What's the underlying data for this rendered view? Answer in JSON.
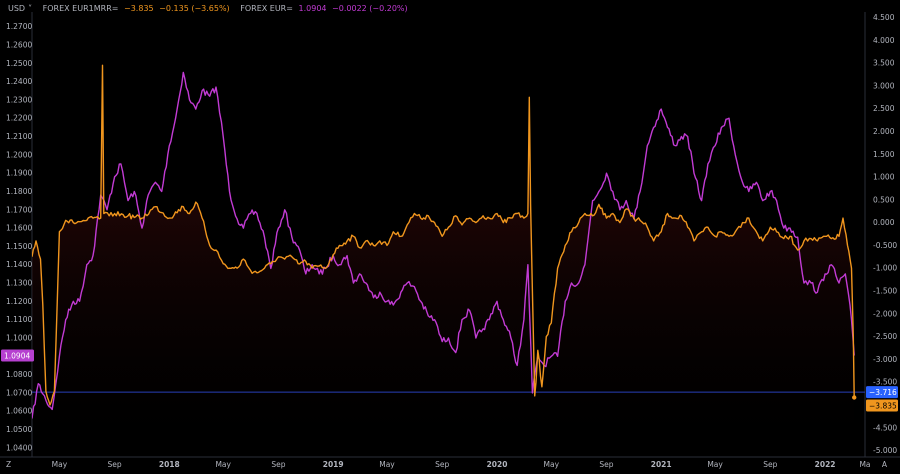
{
  "legend": {
    "currency": "USD",
    "currency_caret": "˅",
    "s1_name": "FOREX EUR1MRR=",
    "s1_value": "−3.835",
    "s1_change": "−0.135 (−3.65%)",
    "s2_name": "FOREX EUR=",
    "s2_value": "1.0904",
    "s2_change": "−0.0022 (−0.20%)"
  },
  "bottom_bar": {
    "left": "Z",
    "right": "A"
  },
  "badges": {
    "left_price": "1.0904",
    "right_a": "−3.716",
    "right_b": "−3.835"
  },
  "colors": {
    "eur_line": "#c23bd4",
    "eur1mrr_line": "#f0961e",
    "fill_top": "#4a0e0e",
    "baseline": "#2a3fb8",
    "badge_blue": "#2962ff",
    "badge_orange": "#f0961e",
    "badge_purple": "#b640d0"
  },
  "chart_data": {
    "type": "line",
    "x_range": [
      "2017-03-01",
      "2022-03-31"
    ],
    "x_tick_labels": [
      "May",
      "Sep",
      "2018",
      "May",
      "Sep",
      "2019",
      "May",
      "Sep",
      "2020",
      "May",
      "Sep",
      "2021",
      "May",
      "Sep",
      "2022",
      "Ma"
    ],
    "left_axis": {
      "ylim": [
        1.035,
        1.278
      ],
      "ticks": [
        "1.2700",
        "1.2600",
        "1.2500",
        "1.2400",
        "1.2300",
        "1.2200",
        "1.2100",
        "1.2000",
        "1.1900",
        "1.1800",
        "1.1700",
        "1.1600",
        "1.1500",
        "1.1400",
        "1.1300",
        "1.1200",
        "1.1100",
        "1.1000",
        "1.0900",
        "1.0800",
        "1.0700",
        "1.0600",
        "1.0500",
        "1.0400"
      ]
    },
    "right_axis": {
      "ylim": [
        -5.14,
        4.62
      ],
      "ticks": [
        "4.500",
        "4.000",
        "3.500",
        "3.000",
        "2.500",
        "2.000",
        "1.500",
        "1.000",
        "0.500",
        "0.000",
        "-0.500",
        "-1.000",
        "-1.500",
        "-2.000",
        "-2.500",
        "-3.000",
        "-3.500",
        "-4.000",
        "-4.500",
        "-5.000"
      ]
    },
    "series": [
      {
        "name": "FOREX EUR=",
        "axis": "left",
        "points": [
          [
            "2017-03-01",
            1.056
          ],
          [
            "2017-03-15",
            1.075
          ],
          [
            "2017-04-01",
            1.066
          ],
          [
            "2017-04-15",
            1.061
          ],
          [
            "2017-05-01",
            1.09
          ],
          [
            "2017-05-15",
            1.11
          ],
          [
            "2017-06-01",
            1.12
          ],
          [
            "2017-06-15",
            1.12
          ],
          [
            "2017-07-01",
            1.14
          ],
          [
            "2017-07-15",
            1.145
          ],
          [
            "2017-08-01",
            1.178
          ],
          [
            "2017-08-15",
            1.17
          ],
          [
            "2017-09-01",
            1.188
          ],
          [
            "2017-09-15",
            1.195
          ],
          [
            "2017-10-01",
            1.175
          ],
          [
            "2017-10-15",
            1.18
          ],
          [
            "2017-11-01",
            1.16
          ],
          [
            "2017-11-15",
            1.178
          ],
          [
            "2017-12-01",
            1.185
          ],
          [
            "2017-12-15",
            1.18
          ],
          [
            "2018-01-01",
            1.205
          ],
          [
            "2018-01-15",
            1.22
          ],
          [
            "2018-02-01",
            1.245
          ],
          [
            "2018-02-15",
            1.23
          ],
          [
            "2018-03-01",
            1.225
          ],
          [
            "2018-03-15",
            1.235
          ],
          [
            "2018-04-01",
            1.232
          ],
          [
            "2018-04-15",
            1.237
          ],
          [
            "2018-05-01",
            1.21
          ],
          [
            "2018-05-15",
            1.18
          ],
          [
            "2018-06-01",
            1.165
          ],
          [
            "2018-06-15",
            1.16
          ],
          [
            "2018-07-01",
            1.168
          ],
          [
            "2018-07-15",
            1.168
          ],
          [
            "2018-08-01",
            1.155
          ],
          [
            "2018-08-15",
            1.138
          ],
          [
            "2018-09-01",
            1.16
          ],
          [
            "2018-09-15",
            1.17
          ],
          [
            "2018-10-01",
            1.155
          ],
          [
            "2018-10-15",
            1.15
          ],
          [
            "2018-11-01",
            1.135
          ],
          [
            "2018-11-15",
            1.14
          ],
          [
            "2018-12-01",
            1.135
          ],
          [
            "2018-12-15",
            1.138
          ],
          [
            "2019-01-01",
            1.145
          ],
          [
            "2019-01-15",
            1.14
          ],
          [
            "2019-02-01",
            1.145
          ],
          [
            "2019-02-15",
            1.13
          ],
          [
            "2019-03-01",
            1.135
          ],
          [
            "2019-03-15",
            1.13
          ],
          [
            "2019-04-01",
            1.122
          ],
          [
            "2019-04-15",
            1.125
          ],
          [
            "2019-05-01",
            1.12
          ],
          [
            "2019-05-15",
            1.118
          ],
          [
            "2019-06-01",
            1.125
          ],
          [
            "2019-06-15",
            1.13
          ],
          [
            "2019-07-01",
            1.128
          ],
          [
            "2019-07-15",
            1.12
          ],
          [
            "2019-08-01",
            1.112
          ],
          [
            "2019-08-15",
            1.11
          ],
          [
            "2019-09-01",
            1.098
          ],
          [
            "2019-09-15",
            1.1
          ],
          [
            "2019-10-01",
            1.092
          ],
          [
            "2019-10-15",
            1.11
          ],
          [
            "2019-11-01",
            1.115
          ],
          [
            "2019-11-15",
            1.1
          ],
          [
            "2019-12-01",
            1.105
          ],
          [
            "2019-12-15",
            1.11
          ],
          [
            "2020-01-01",
            1.12
          ],
          [
            "2020-01-15",
            1.11
          ],
          [
            "2020-02-01",
            1.1
          ],
          [
            "2020-02-15",
            1.085
          ],
          [
            "2020-03-01",
            1.11
          ],
          [
            "2020-03-10",
            1.14
          ],
          [
            "2020-03-20",
            1.07
          ],
          [
            "2020-04-01",
            1.09
          ],
          [
            "2020-04-15",
            1.085
          ],
          [
            "2020-05-01",
            1.09
          ],
          [
            "2020-05-15",
            1.09
          ],
          [
            "2020-06-01",
            1.12
          ],
          [
            "2020-06-15",
            1.13
          ],
          [
            "2020-07-01",
            1.13
          ],
          [
            "2020-07-15",
            1.14
          ],
          [
            "2020-08-01",
            1.175
          ],
          [
            "2020-08-15",
            1.18
          ],
          [
            "2020-09-01",
            1.19
          ],
          [
            "2020-09-15",
            1.18
          ],
          [
            "2020-10-01",
            1.17
          ],
          [
            "2020-10-15",
            1.175
          ],
          [
            "2020-11-01",
            1.165
          ],
          [
            "2020-11-15",
            1.18
          ],
          [
            "2020-12-01",
            1.205
          ],
          [
            "2020-12-15",
            1.215
          ],
          [
            "2021-01-01",
            1.225
          ],
          [
            "2021-01-15",
            1.215
          ],
          [
            "2021-02-01",
            1.205
          ],
          [
            "2021-02-15",
            1.21
          ],
          [
            "2021-03-01",
            1.21
          ],
          [
            "2021-03-15",
            1.19
          ],
          [
            "2021-04-01",
            1.175
          ],
          [
            "2021-04-15",
            1.195
          ],
          [
            "2021-05-01",
            1.205
          ],
          [
            "2021-05-15",
            1.215
          ],
          [
            "2021-06-01",
            1.22
          ],
          [
            "2021-06-15",
            1.2
          ],
          [
            "2021-07-01",
            1.185
          ],
          [
            "2021-07-15",
            1.18
          ],
          [
            "2021-08-01",
            1.185
          ],
          [
            "2021-08-15",
            1.175
          ],
          [
            "2021-09-01",
            1.18
          ],
          [
            "2021-09-15",
            1.175
          ],
          [
            "2021-10-01",
            1.16
          ],
          [
            "2021-10-15",
            1.16
          ],
          [
            "2021-11-01",
            1.155
          ],
          [
            "2021-11-15",
            1.13
          ],
          [
            "2021-12-01",
            1.13
          ],
          [
            "2021-12-15",
            1.125
          ],
          [
            "2022-01-01",
            1.135
          ],
          [
            "2022-01-15",
            1.14
          ],
          [
            "2022-02-01",
            1.13
          ],
          [
            "2022-02-15",
            1.135
          ],
          [
            "2022-03-01",
            1.11
          ],
          [
            "2022-03-07",
            1.0904
          ]
        ]
      },
      {
        "name": "FOREX EUR1MRR=",
        "axis": "right",
        "points": [
          [
            "2017-03-01",
            -0.75
          ],
          [
            "2017-03-10",
            -0.4
          ],
          [
            "2017-03-20",
            -0.8
          ],
          [
            "2017-03-25",
            -1.8
          ],
          [
            "2017-04-01",
            -3.7
          ],
          [
            "2017-04-10",
            -4.0
          ],
          [
            "2017-04-20",
            -3.7
          ],
          [
            "2017-05-01",
            -0.2
          ],
          [
            "2017-05-15",
            0.05
          ],
          [
            "2017-06-01",
            0.0
          ],
          [
            "2017-06-15",
            0.02
          ],
          [
            "2017-07-01",
            0.05
          ],
          [
            "2017-07-15",
            0.1
          ],
          [
            "2017-08-01",
            0.1
          ],
          [
            "2017-08-05",
            3.45
          ],
          [
            "2017-08-08",
            0.2
          ],
          [
            "2017-08-20",
            0.15
          ],
          [
            "2017-09-01",
            0.2
          ],
          [
            "2017-10-01",
            0.15
          ],
          [
            "2017-11-01",
            0.1
          ],
          [
            "2017-12-01",
            0.35
          ],
          [
            "2018-01-01",
            0.1
          ],
          [
            "2018-02-01",
            0.35
          ],
          [
            "2018-02-15",
            0.2
          ],
          [
            "2018-03-01",
            0.45
          ],
          [
            "2018-03-15",
            0.1
          ],
          [
            "2018-04-01",
            -0.5
          ],
          [
            "2018-04-15",
            -0.6
          ],
          [
            "2018-05-01",
            -0.9
          ],
          [
            "2018-05-15",
            -1.0
          ],
          [
            "2018-06-01",
            -1.0
          ],
          [
            "2018-06-15",
            -0.8
          ],
          [
            "2018-07-01",
            -1.05
          ],
          [
            "2018-07-15",
            -1.1
          ],
          [
            "2018-08-01",
            -1.0
          ],
          [
            "2018-08-15",
            -0.9
          ],
          [
            "2018-09-01",
            -0.75
          ],
          [
            "2018-09-15",
            -0.8
          ],
          [
            "2018-10-01",
            -0.75
          ],
          [
            "2018-10-15",
            -0.9
          ],
          [
            "2018-11-01",
            -0.85
          ],
          [
            "2018-11-15",
            -1.0
          ],
          [
            "2018-12-01",
            -0.95
          ],
          [
            "2018-12-15",
            -1.0
          ],
          [
            "2019-01-01",
            -0.7
          ],
          [
            "2019-01-15",
            -0.5
          ],
          [
            "2019-02-01",
            -0.4
          ],
          [
            "2019-02-15",
            -0.3
          ],
          [
            "2019-03-01",
            -0.55
          ],
          [
            "2019-03-15",
            -0.4
          ],
          [
            "2019-04-01",
            -0.5
          ],
          [
            "2019-04-15",
            -0.4
          ],
          [
            "2019-05-01",
            -0.5
          ],
          [
            "2019-05-15",
            -0.2
          ],
          [
            "2019-06-01",
            -0.3
          ],
          [
            "2019-06-15",
            -0.05
          ],
          [
            "2019-07-01",
            0.2
          ],
          [
            "2019-07-15",
            0.1
          ],
          [
            "2019-08-01",
            0.15
          ],
          [
            "2019-08-15",
            0.0
          ],
          [
            "2019-09-01",
            -0.3
          ],
          [
            "2019-09-15",
            -0.1
          ],
          [
            "2019-10-01",
            0.15
          ],
          [
            "2019-10-15",
            -0.05
          ],
          [
            "2019-11-01",
            0.1
          ],
          [
            "2019-11-15",
            0.0
          ],
          [
            "2019-12-01",
            0.15
          ],
          [
            "2019-12-15",
            0.1
          ],
          [
            "2020-01-01",
            0.2
          ],
          [
            "2020-01-15",
            0.0
          ],
          [
            "2020-02-01",
            0.1
          ],
          [
            "2020-02-15",
            0.2
          ],
          [
            "2020-03-01",
            0.1
          ],
          [
            "2020-03-10",
            0.2
          ],
          [
            "2020-03-13",
            2.75
          ],
          [
            "2020-03-16",
            0.4
          ],
          [
            "2020-03-20",
            -1.5
          ],
          [
            "2020-03-25",
            -3.8
          ],
          [
            "2020-03-28",
            -3.5
          ],
          [
            "2020-04-01",
            -2.8
          ],
          [
            "2020-04-10",
            -3.6
          ],
          [
            "2020-04-20",
            -2.5
          ],
          [
            "2020-05-01",
            -2.2
          ],
          [
            "2020-05-15",
            -1.0
          ],
          [
            "2020-06-01",
            -0.5
          ],
          [
            "2020-06-15",
            -0.2
          ],
          [
            "2020-07-01",
            0.0
          ],
          [
            "2020-07-15",
            0.2
          ],
          [
            "2020-08-01",
            0.15
          ],
          [
            "2020-08-15",
            0.4
          ],
          [
            "2020-09-01",
            0.1
          ],
          [
            "2020-09-15",
            0.2
          ],
          [
            "2020-10-01",
            0.0
          ],
          [
            "2020-10-15",
            0.3
          ],
          [
            "2020-11-01",
            0.1
          ],
          [
            "2020-11-15",
            0.05
          ],
          [
            "2020-12-01",
            -0.1
          ],
          [
            "2020-12-15",
            -0.4
          ],
          [
            "2021-01-01",
            -0.2
          ],
          [
            "2021-01-15",
            0.2
          ],
          [
            "2021-02-01",
            0.1
          ],
          [
            "2021-02-15",
            0.15
          ],
          [
            "2021-03-01",
            -0.1
          ],
          [
            "2021-03-15",
            -0.4
          ],
          [
            "2021-04-01",
            -0.2
          ],
          [
            "2021-04-15",
            -0.1
          ],
          [
            "2021-05-01",
            -0.3
          ],
          [
            "2021-05-15",
            -0.2
          ],
          [
            "2021-06-01",
            -0.3
          ],
          [
            "2021-06-15",
            -0.2
          ],
          [
            "2021-07-01",
            0.0
          ],
          [
            "2021-07-15",
            0.1
          ],
          [
            "2021-08-01",
            -0.2
          ],
          [
            "2021-08-15",
            -0.4
          ],
          [
            "2021-09-01",
            -0.1
          ],
          [
            "2021-09-15",
            -0.2
          ],
          [
            "2021-10-01",
            -0.35
          ],
          [
            "2021-10-15",
            -0.3
          ],
          [
            "2021-11-01",
            -0.6
          ],
          [
            "2021-11-15",
            -0.4
          ],
          [
            "2021-12-01",
            -0.35
          ],
          [
            "2021-12-15",
            -0.4
          ],
          [
            "2022-01-01",
            -0.3
          ],
          [
            "2022-01-15",
            -0.35
          ],
          [
            "2022-02-01",
            -0.3
          ],
          [
            "2022-02-10",
            0.1
          ],
          [
            "2022-02-20",
            -0.5
          ],
          [
            "2022-03-01",
            -1.0
          ],
          [
            "2022-03-05",
            -2.5
          ],
          [
            "2022-03-07",
            -3.835
          ]
        ]
      }
    ],
    "reference_line": {
      "axis": "right",
      "value": -3.716
    },
    "grid": false,
    "legend_position": "top-left"
  }
}
